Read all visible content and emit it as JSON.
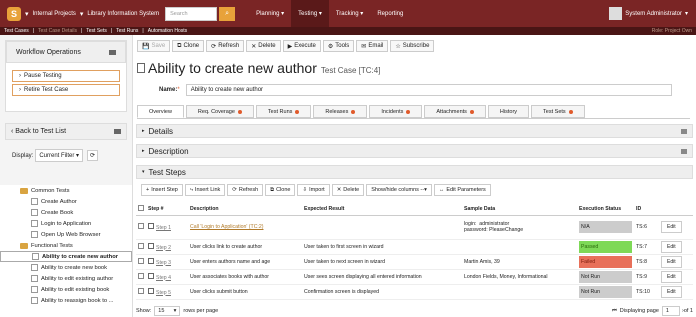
{
  "topbar": {
    "project": "Internal Projects",
    "system": "Library Information System",
    "search_placeholder": "Search",
    "menus": [
      "Planning",
      "Testing",
      "Tracking",
      "Reporting"
    ],
    "active_menu": "Testing",
    "user": "System Administrator"
  },
  "breadcrumbs": [
    "Test Cases",
    "Test Case Details",
    "Test Sets",
    "Test Runs",
    "Automation Hosts"
  ],
  "crumb_right": "Role: Project Own",
  "left": {
    "workflow_title": "Workflow Operations",
    "workflow_actions": [
      "Pause Testing",
      "Retire Test Case"
    ],
    "back_label": "Back to Test List",
    "display_label": "Display:",
    "display_value": "Current Filter",
    "tree": [
      {
        "label": "Common Tests",
        "type": "folder",
        "indent": 0
      },
      {
        "label": "Create Author",
        "type": "leaf",
        "indent": 1
      },
      {
        "label": "Create Book",
        "type": "leaf",
        "indent": 1
      },
      {
        "label": "Login to Application",
        "type": "leaf",
        "indent": 1
      },
      {
        "label": "Open Up Web Browser",
        "type": "leaf",
        "indent": 1
      },
      {
        "label": "Functional Tests",
        "type": "folder",
        "indent": 0
      },
      {
        "label": "Ability to create new author",
        "type": "leaf",
        "indent": 1,
        "selected": true
      },
      {
        "label": "Ability to create new book",
        "type": "leaf",
        "indent": 1
      },
      {
        "label": "Ability to edit existing author",
        "type": "leaf",
        "indent": 1
      },
      {
        "label": "Ability to edit existing book",
        "type": "leaf",
        "indent": 1
      },
      {
        "label": "Ability to reassign book to ...",
        "type": "leaf",
        "indent": 1
      }
    ]
  },
  "toolbar": [
    "Save",
    "Clone",
    "Refresh",
    "Delete",
    "Execute",
    "Tools",
    "Email",
    "Subscribe"
  ],
  "header": {
    "title": "Ability to create new author",
    "subtitle": "Test Case [TC:4]",
    "name_label": "Name:",
    "name_value": "Ability to create new author"
  },
  "tabs": [
    {
      "label": "Overview",
      "dot": false,
      "active": true
    },
    {
      "label": "Req. Coverage",
      "dot": true
    },
    {
      "label": "Test Runs",
      "dot": true
    },
    {
      "label": "Releases",
      "dot": true
    },
    {
      "label": "Incidents",
      "dot": true
    },
    {
      "label": "Attachments",
      "dot": true
    },
    {
      "label": "History",
      "dot": false
    },
    {
      "label": "Test Sets",
      "dot": true
    }
  ],
  "sections": [
    "Details",
    "Description",
    "Test Steps"
  ],
  "steps_toolbar": [
    "Insert Step",
    "Insert Link",
    "Refresh",
    "Clone",
    "Import",
    "Delete",
    "Show/hide columns --",
    "Edit Parameters"
  ],
  "table": {
    "headers": [
      "",
      "Step #",
      "Description",
      "Expected Result",
      "Sample Data",
      "Execution Status",
      "ID",
      ""
    ],
    "rows": [
      {
        "step": "Step 1",
        "description": "Call 'Login to Application' (TC:2)",
        "expected": "",
        "sample": "login:  administrator\npassword: PleaseChange",
        "status": "N/A",
        "status_color": "#cccccc",
        "id": "TS:6",
        "edit": "Edit"
      },
      {
        "step": "Step 2",
        "description": "User clicks link to create author",
        "expected": "User taken to first screen in wizard",
        "sample": "",
        "status": "Passed",
        "status_color": "#7ed957",
        "id": "TS:7",
        "edit": "Edit"
      },
      {
        "step": "Step 3",
        "description": "User enters authors name and age",
        "expected": "User taken to next screen in wizard",
        "sample": "Martin Amis, 39",
        "status": "Failed",
        "status_color": "#e8705a",
        "id": "TS:8",
        "edit": "Edit"
      },
      {
        "step": "Step 4",
        "description": "User associates books with author",
        "expected": "User sees screen displaying all entered information",
        "sample": "London Fields, Money, Informational",
        "status": "Not Run",
        "status_color": "#cccccc",
        "id": "TS:9",
        "edit": "Edit"
      },
      {
        "step": "Step 5",
        "description": "User clicks submit button",
        "expected": "Confirmation screen is displayed",
        "sample": "",
        "status": "Not Run",
        "status_color": "#cccccc",
        "id": "TS:10",
        "edit": "Edit"
      }
    ]
  },
  "footer": {
    "show_label": "Show:",
    "show_value": "15",
    "rows_label": "rows per page",
    "displaying_label": "Displaying page",
    "page_value": "1",
    "of_label": "of 1"
  }
}
